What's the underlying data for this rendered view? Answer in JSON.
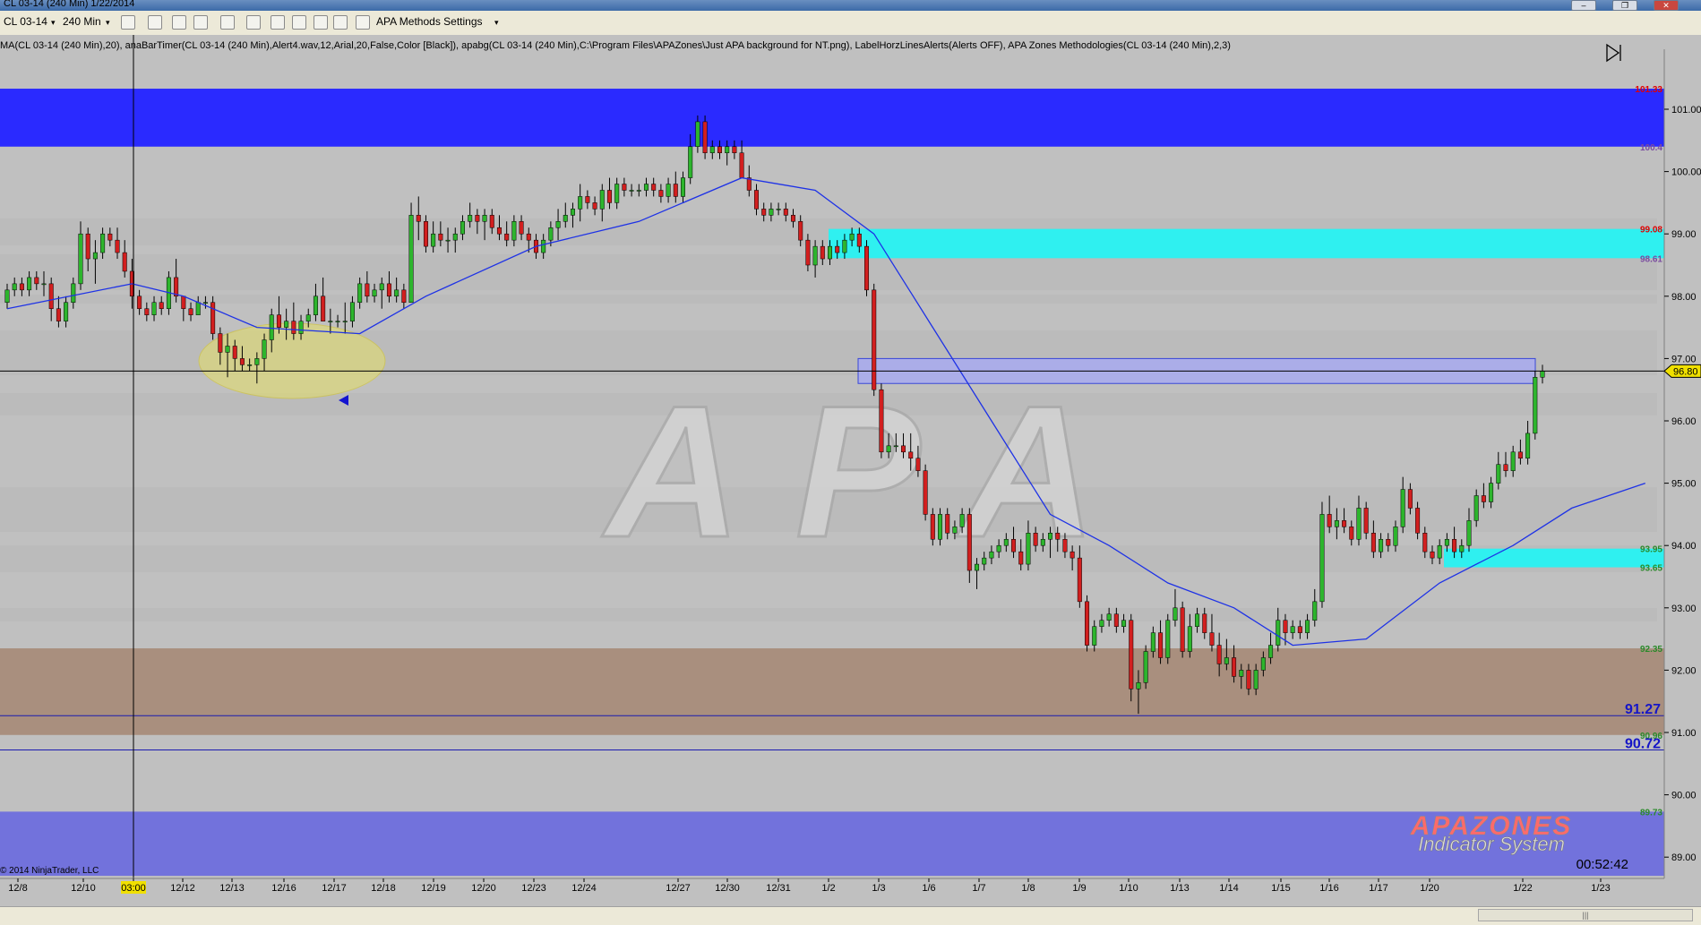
{
  "window": {
    "title": "CL 03-14 (240 Min)  1/22/2014",
    "minimize_glyph": "–",
    "restore_glyph": "❐",
    "close_glyph": "✕"
  },
  "toolbar": {
    "instrument": "CL 03-14",
    "interval": "240 Min",
    "settings_label": "APA Methods Settings",
    "dropdown_glyph": "▾"
  },
  "indicators_text": "MA(CL 03-14 (240 Min),20), anaBarTimer(CL 03-14 (240 Min),Alert4.wav,12,Arial,20,False,Color [Black]), apabg(CL 03-14 (240 Min),C:\\Program Files\\APAZones\\Just APA background for NT.png), LabelHorzLinesAlerts(Alerts OFF), APA Zones Methodologies(CL 03-14 (240 Min),2,3)",
  "copyright": "© 2014 NinjaTrader, LLC",
  "timer": "00:52:42",
  "logo": {
    "line1": "APAZONES",
    "line2": "Indicator System",
    "watermark": "APA"
  },
  "scroll_grip": "|||",
  "colors": {
    "background": "#c0c0c0",
    "resistance_zone": "#2a2aff",
    "support_zone": "#7272dc",
    "supply_cyan": "#2ff0f0",
    "demand_brown": "#a98f7e",
    "up_candle": "#2db52d",
    "down_candle": "#d21f1f",
    "ma_line": "#1e32e6",
    "highlight_ellipse": "#e6e066"
  },
  "chart_data": {
    "type": "candlestick",
    "ylim": [
      88.7,
      101.8
    ],
    "y_ticks": [
      "101.00",
      "100.00",
      "99.00",
      "98.00",
      "97.00",
      "96.00",
      "95.00",
      "94.00",
      "93.00",
      "92.00",
      "91.00",
      "90.00",
      "89.00"
    ],
    "x_ticks": [
      "12/8",
      "12/10",
      "03:00",
      "12/12",
      "12/13",
      "12/16",
      "12/17",
      "12/18",
      "12/19",
      "12/20",
      "12/23",
      "12/24",
      "12/27",
      "12/30",
      "12/31",
      "1/2",
      "1/3",
      "1/6",
      "1/7",
      "1/8",
      "1/9",
      "1/10",
      "1/13",
      "1/14",
      "1/15",
      "1/16",
      "1/17",
      "1/20",
      "1/22",
      "1/23"
    ],
    "highlight_x_tick": "03:00",
    "last_price": "96.80",
    "crosshair_price": 96.8,
    "zones": [
      {
        "kind": "resistance",
        "from": 100.4,
        "to": 101.33,
        "labels": [
          "101.33",
          "100.4"
        ]
      },
      {
        "kind": "supply",
        "from": 98.61,
        "to": 99.08,
        "labels": [
          "99.08",
          "98.61"
        ]
      },
      {
        "kind": "demand",
        "from": 93.65,
        "to": 93.95,
        "labels": [
          "93.95",
          "93.65"
        ]
      },
      {
        "kind": "demand_wide",
        "from": 90.96,
        "to": 92.35,
        "labels": [
          "92.35",
          "90.96"
        ]
      },
      {
        "kind": "support",
        "from": 88.7,
        "to": 89.73,
        "labels": [
          "89.73"
        ]
      }
    ],
    "line_labels": [
      {
        "price": 91.27,
        "label": "91.27"
      },
      {
        "price": 90.72,
        "label": "90.72"
      }
    ],
    "candles": [
      [
        97.9,
        98.2,
        97.8,
        98.1
      ],
      [
        98.1,
        98.3,
        98.0,
        98.2
      ],
      [
        98.2,
        98.3,
        98.0,
        98.1
      ],
      [
        98.1,
        98.4,
        98.0,
        98.3
      ],
      [
        98.3,
        98.4,
        98.1,
        98.2
      ],
      [
        98.2,
        98.4,
        98.0,
        98.2
      ],
      [
        98.2,
        98.3,
        97.6,
        97.8
      ],
      [
        97.8,
        98.0,
        97.5,
        97.6
      ],
      [
        97.6,
        98.0,
        97.5,
        97.9
      ],
      [
        97.9,
        98.3,
        97.8,
        98.2
      ],
      [
        98.2,
        99.2,
        98.1,
        99.0
      ],
      [
        99.0,
        99.1,
        98.4,
        98.6
      ],
      [
        98.6,
        98.9,
        98.2,
        98.7
      ],
      [
        98.7,
        99.1,
        98.6,
        99.0
      ],
      [
        99.0,
        99.1,
        98.8,
        98.9
      ],
      [
        98.9,
        99.1,
        98.6,
        98.7
      ],
      [
        98.7,
        98.9,
        98.3,
        98.4
      ],
      [
        98.4,
        98.6,
        97.8,
        98.0
      ],
      [
        98.0,
        98.1,
        97.7,
        97.8
      ],
      [
        97.8,
        97.9,
        97.6,
        97.7
      ],
      [
        97.7,
        98.0,
        97.6,
        97.9
      ],
      [
        97.9,
        98.0,
        97.7,
        97.8
      ],
      [
        97.8,
        98.4,
        97.7,
        98.3
      ],
      [
        98.3,
        98.6,
        97.9,
        98.0
      ],
      [
        98.0,
        98.0,
        97.6,
        97.8
      ],
      [
        97.8,
        97.9,
        97.6,
        97.7
      ],
      [
        97.7,
        98.0,
        97.7,
        97.9
      ],
      [
        97.9,
        98.0,
        97.8,
        97.9
      ],
      [
        97.9,
        98.0,
        97.3,
        97.4
      ],
      [
        97.4,
        97.5,
        96.9,
        97.1
      ],
      [
        97.1,
        97.4,
        96.7,
        97.2
      ],
      [
        97.2,
        97.3,
        96.8,
        97.0
      ],
      [
        97.0,
        97.2,
        96.8,
        96.9
      ],
      [
        96.9,
        97.0,
        96.8,
        96.9
      ],
      [
        96.9,
        97.1,
        96.6,
        97.0
      ],
      [
        97.0,
        97.4,
        96.8,
        97.3
      ],
      [
        97.3,
        97.8,
        97.1,
        97.7
      ],
      [
        97.7,
        98.0,
        97.4,
        97.5
      ],
      [
        97.5,
        97.8,
        97.3,
        97.6
      ],
      [
        97.6,
        97.9,
        97.3,
        97.4
      ],
      [
        97.4,
        97.7,
        97.3,
        97.6
      ],
      [
        97.6,
        97.8,
        97.5,
        97.7
      ],
      [
        97.7,
        98.2,
        97.6,
        98.0
      ],
      [
        98.0,
        98.3,
        97.6,
        97.6
      ],
      [
        97.6,
        97.8,
        97.4,
        97.6
      ],
      [
        97.6,
        97.7,
        97.5,
        97.6
      ],
      [
        97.6,
        97.9,
        97.4,
        97.6
      ],
      [
        97.6,
        98.0,
        97.5,
        97.9
      ],
      [
        97.9,
        98.3,
        97.8,
        98.2
      ],
      [
        98.2,
        98.4,
        97.9,
        98.0
      ],
      [
        98.0,
        98.2,
        97.9,
        98.1
      ],
      [
        98.1,
        98.3,
        97.8,
        98.2
      ],
      [
        98.2,
        98.4,
        97.9,
        98.0
      ],
      [
        98.0,
        98.3,
        97.9,
        98.1
      ],
      [
        98.1,
        98.2,
        97.8,
        97.9
      ],
      [
        97.9,
        99.5,
        97.9,
        99.3
      ],
      [
        99.3,
        99.6,
        98.9,
        99.2
      ],
      [
        99.2,
        99.3,
        98.7,
        98.8
      ],
      [
        98.8,
        99.2,
        98.7,
        99.0
      ],
      [
        99.0,
        99.2,
        98.8,
        98.9
      ],
      [
        98.9,
        99.1,
        98.7,
        98.9
      ],
      [
        98.9,
        99.1,
        98.7,
        99.0
      ],
      [
        99.0,
        99.3,
        98.9,
        99.2
      ],
      [
        99.2,
        99.5,
        99.1,
        99.3
      ],
      [
        99.3,
        99.4,
        99.0,
        99.2
      ],
      [
        99.2,
        99.4,
        98.9,
        99.3
      ],
      [
        99.3,
        99.4,
        99.0,
        99.1
      ],
      [
        99.1,
        99.3,
        98.9,
        99.0
      ],
      [
        99.0,
        99.2,
        98.8,
        98.9
      ],
      [
        98.9,
        99.3,
        98.8,
        99.2
      ],
      [
        99.2,
        99.3,
        98.9,
        99.0
      ],
      [
        99.0,
        99.1,
        98.7,
        98.9
      ],
      [
        98.9,
        99.0,
        98.6,
        98.7
      ],
      [
        98.7,
        99.0,
        98.6,
        98.9
      ],
      [
        98.9,
        99.2,
        98.8,
        99.1
      ],
      [
        99.1,
        99.4,
        98.9,
        99.2
      ],
      [
        99.2,
        99.5,
        99.1,
        99.3
      ],
      [
        99.3,
        99.5,
        99.1,
        99.4
      ],
      [
        99.4,
        99.8,
        99.2,
        99.6
      ],
      [
        99.6,
        99.7,
        99.4,
        99.5
      ],
      [
        99.5,
        99.6,
        99.3,
        99.4
      ],
      [
        99.4,
        99.8,
        99.2,
        99.7
      ],
      [
        99.7,
        99.9,
        99.4,
        99.5
      ],
      [
        99.5,
        99.9,
        99.4,
        99.8
      ],
      [
        99.8,
        99.9,
        99.6,
        99.7
      ],
      [
        99.7,
        99.8,
        99.6,
        99.7
      ],
      [
        99.7,
        99.8,
        99.6,
        99.7
      ],
      [
        99.7,
        99.9,
        99.6,
        99.8
      ],
      [
        99.8,
        99.9,
        99.6,
        99.7
      ],
      [
        99.7,
        99.8,
        99.5,
        99.6
      ],
      [
        99.6,
        99.9,
        99.5,
        99.8
      ],
      [
        99.8,
        100.0,
        99.5,
        99.6
      ],
      [
        99.6,
        100.0,
        99.5,
        99.9
      ],
      [
        99.9,
        100.6,
        99.8,
        100.4
      ],
      [
        100.4,
        100.9,
        100.3,
        100.8
      ],
      [
        100.8,
        100.9,
        100.2,
        100.3
      ],
      [
        100.3,
        100.5,
        100.2,
        100.4
      ],
      [
        100.4,
        100.5,
        100.2,
        100.3
      ],
      [
        100.3,
        100.5,
        100.1,
        100.4
      ],
      [
        100.4,
        100.5,
        100.2,
        100.3
      ],
      [
        100.3,
        100.5,
        99.9,
        99.9
      ],
      [
        99.9,
        100.1,
        99.6,
        99.7
      ],
      [
        99.7,
        99.8,
        99.3,
        99.4
      ],
      [
        99.4,
        99.5,
        99.2,
        99.3
      ],
      [
        99.3,
        99.5,
        99.2,
        99.4
      ],
      [
        99.4,
        99.5,
        99.3,
        99.4
      ],
      [
        99.4,
        99.5,
        99.2,
        99.3
      ],
      [
        99.3,
        99.4,
        99.1,
        99.2
      ],
      [
        99.2,
        99.3,
        98.8,
        98.9
      ],
      [
        98.9,
        99.0,
        98.4,
        98.5
      ],
      [
        98.5,
        98.9,
        98.3,
        98.8
      ],
      [
        98.8,
        98.9,
        98.5,
        98.6
      ],
      [
        98.6,
        98.9,
        98.5,
        98.8
      ],
      [
        98.8,
        98.9,
        98.6,
        98.7
      ],
      [
        98.7,
        99.0,
        98.6,
        98.9
      ],
      [
        98.9,
        99.1,
        98.8,
        99.0
      ],
      [
        99.0,
        99.1,
        98.7,
        98.8
      ],
      [
        98.8,
        98.9,
        98.0,
        98.1
      ],
      [
        98.1,
        98.2,
        96.4,
        96.5
      ],
      [
        96.5,
        96.6,
        95.4,
        95.5
      ],
      [
        95.5,
        95.8,
        95.4,
        95.6
      ],
      [
        95.6,
        95.8,
        95.5,
        95.6
      ],
      [
        95.6,
        95.8,
        95.4,
        95.5
      ],
      [
        95.5,
        95.8,
        95.2,
        95.4
      ],
      [
        95.4,
        95.6,
        95.1,
        95.2
      ],
      [
        95.2,
        95.3,
        94.4,
        94.5
      ],
      [
        94.5,
        94.6,
        94.0,
        94.1
      ],
      [
        94.1,
        94.6,
        94.0,
        94.5
      ],
      [
        94.5,
        94.6,
        94.1,
        94.2
      ],
      [
        94.2,
        94.4,
        94.1,
        94.3
      ],
      [
        94.3,
        94.6,
        94.2,
        94.5
      ],
      [
        94.5,
        94.6,
        93.4,
        93.6
      ],
      [
        93.6,
        93.8,
        93.3,
        93.7
      ],
      [
        93.7,
        93.9,
        93.6,
        93.8
      ],
      [
        93.8,
        94.0,
        93.7,
        93.9
      ],
      [
        93.9,
        94.1,
        93.8,
        94.0
      ],
      [
        94.0,
        94.2,
        93.9,
        94.1
      ],
      [
        94.1,
        94.3,
        93.8,
        93.9
      ],
      [
        93.9,
        94.1,
        93.6,
        93.7
      ],
      [
        93.7,
        94.4,
        93.6,
        94.2
      ],
      [
        94.2,
        94.3,
        93.9,
        94.0
      ],
      [
        94.0,
        94.2,
        93.9,
        94.1
      ],
      [
        94.1,
        94.3,
        93.8,
        94.2
      ],
      [
        94.2,
        94.3,
        93.9,
        94.1
      ],
      [
        94.1,
        94.2,
        93.8,
        93.9
      ],
      [
        93.9,
        94.0,
        93.6,
        93.8
      ],
      [
        93.8,
        94.0,
        93.0,
        93.1
      ],
      [
        93.1,
        93.2,
        92.3,
        92.4
      ],
      [
        92.4,
        92.8,
        92.3,
        92.7
      ],
      [
        92.7,
        92.9,
        92.6,
        92.8
      ],
      [
        92.8,
        93.0,
        92.7,
        92.9
      ],
      [
        92.9,
        93.0,
        92.6,
        92.7
      ],
      [
        92.7,
        92.9,
        92.6,
        92.8
      ],
      [
        92.8,
        92.9,
        91.5,
        91.7
      ],
      [
        91.7,
        92.0,
        91.3,
        91.8
      ],
      [
        91.8,
        92.4,
        91.7,
        92.3
      ],
      [
        92.3,
        92.7,
        92.2,
        92.6
      ],
      [
        92.6,
        92.8,
        92.1,
        92.2
      ],
      [
        92.2,
        92.9,
        92.1,
        92.8
      ],
      [
        92.8,
        93.3,
        92.7,
        93.0
      ],
      [
        93.0,
        93.1,
        92.2,
        92.3
      ],
      [
        92.3,
        92.9,
        92.2,
        92.7
      ],
      [
        92.7,
        93.0,
        92.6,
        92.9
      ],
      [
        92.9,
        93.0,
        92.5,
        92.6
      ],
      [
        92.6,
        92.9,
        92.3,
        92.4
      ],
      [
        92.4,
        92.6,
        91.9,
        92.1
      ],
      [
        92.1,
        92.5,
        92.0,
        92.2
      ],
      [
        92.2,
        92.4,
        91.8,
        91.9
      ],
      [
        91.9,
        92.1,
        91.7,
        92.0
      ],
      [
        92.0,
        92.1,
        91.6,
        91.7
      ],
      [
        91.7,
        92.1,
        91.6,
        92.0
      ],
      [
        92.0,
        92.3,
        91.9,
        92.2
      ],
      [
        92.2,
        92.6,
        92.1,
        92.4
      ],
      [
        92.4,
        93.0,
        92.3,
        92.8
      ],
      [
        92.8,
        92.9,
        92.4,
        92.6
      ],
      [
        92.6,
        92.8,
        92.5,
        92.7
      ],
      [
        92.7,
        92.8,
        92.5,
        92.6
      ],
      [
        92.6,
        92.9,
        92.5,
        92.8
      ],
      [
        92.8,
        93.3,
        92.7,
        93.1
      ],
      [
        93.1,
        94.7,
        93.0,
        94.5
      ],
      [
        94.5,
        94.8,
        94.2,
        94.3
      ],
      [
        94.3,
        94.6,
        94.1,
        94.4
      ],
      [
        94.4,
        94.6,
        94.2,
        94.3
      ],
      [
        94.3,
        94.4,
        94.0,
        94.1
      ],
      [
        94.1,
        94.8,
        94.0,
        94.6
      ],
      [
        94.6,
        94.7,
        94.1,
        94.2
      ],
      [
        94.2,
        94.4,
        93.8,
        93.9
      ],
      [
        93.9,
        94.2,
        93.8,
        94.1
      ],
      [
        94.1,
        94.2,
        93.9,
        94.0
      ],
      [
        94.0,
        94.4,
        93.9,
        94.3
      ],
      [
        94.3,
        95.1,
        94.2,
        94.9
      ],
      [
        94.9,
        95.0,
        94.5,
        94.6
      ],
      [
        94.6,
        94.7,
        94.1,
        94.2
      ],
      [
        94.2,
        94.3,
        93.8,
        93.9
      ],
      [
        93.9,
        94.0,
        93.7,
        93.8
      ],
      [
        93.8,
        94.1,
        93.7,
        94.0
      ],
      [
        94.0,
        94.2,
        93.9,
        94.1
      ],
      [
        94.1,
        94.3,
        93.8,
        93.9
      ],
      [
        93.9,
        94.1,
        93.8,
        94.0
      ],
      [
        94.0,
        94.6,
        93.9,
        94.4
      ],
      [
        94.4,
        94.9,
        94.3,
        94.8
      ],
      [
        94.8,
        95.0,
        94.6,
        94.7
      ],
      [
        94.7,
        95.1,
        94.6,
        95.0
      ],
      [
        95.0,
        95.5,
        94.9,
        95.3
      ],
      [
        95.3,
        95.5,
        95.1,
        95.2
      ],
      [
        95.2,
        95.6,
        95.1,
        95.5
      ],
      [
        95.5,
        95.7,
        95.3,
        95.4
      ],
      [
        95.4,
        96.0,
        95.3,
        95.8
      ],
      [
        95.8,
        96.8,
        95.7,
        96.7
      ],
      [
        96.7,
        96.9,
        96.6,
        96.8
      ]
    ],
    "ma_points": [
      [
        0,
        97.8
      ],
      [
        17,
        98.2
      ],
      [
        24,
        98.0
      ],
      [
        34,
        97.5
      ],
      [
        48,
        97.4
      ],
      [
        57,
        98.0
      ],
      [
        72,
        98.8
      ],
      [
        86,
        99.2
      ],
      [
        100,
        99.9
      ],
      [
        110,
        99.7
      ],
      [
        118,
        99.0
      ],
      [
        126,
        97.5
      ],
      [
        134,
        96.0
      ],
      [
        142,
        94.5
      ],
      [
        150,
        94.0
      ],
      [
        158,
        93.4
      ],
      [
        167,
        93.0
      ],
      [
        175,
        92.4
      ],
      [
        185,
        92.5
      ],
      [
        195,
        93.4
      ],
      [
        205,
        94.0
      ],
      [
        213,
        94.6
      ],
      [
        223,
        95.0
      ]
    ]
  }
}
